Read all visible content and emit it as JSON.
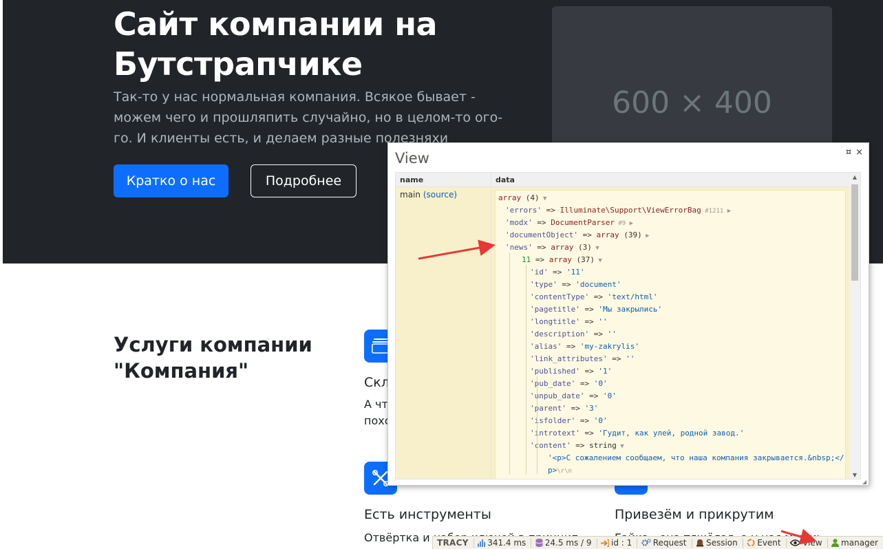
{
  "hero": {
    "title": "Сайт компании на Бутстрапчике",
    "lead": "Так-то у нас нормальная компания. Всякое бывает - можем чего и прошляпить случайно, но в целом-то ого-го. И клиенты есть, и делаем разные полезняхи",
    "primary_button": "Кратко о нас",
    "secondary_button": "Подробнее",
    "image_placeholder": "600 × 400"
  },
  "features": {
    "title": "Услуги компании \"Компания\"",
    "items": [
      {
        "heading": "Скл",
        "text_1": "А что",
        "text_2": "похо"
      },
      {
        "heading": "Есть инструменты",
        "text_1": "Отвёртка и набор ключей в принципе же"
      },
      {
        "heading": "Привезём и прикрутим",
        "text_1": "Гайка - она тяжёлая, а у нас мужик"
      }
    ]
  },
  "tracy_panel": {
    "title": "View",
    "pin_icon": "¤",
    "close_icon": "×",
    "col_name": "name",
    "col_data": "data",
    "row_name": "main",
    "row_source": "(source)",
    "dump": [
      {
        "indent": 0,
        "parts": [
          [
            "arr",
            "array"
          ],
          [
            "plain",
            " (4)"
          ],
          [
            "tri",
            " ▼"
          ]
        ]
      },
      {
        "indent": 1,
        "parts": [
          [
            "k",
            "'errors'"
          ],
          [
            "plain",
            " => "
          ],
          [
            "obj",
            "Illuminate\\Support\\ViewErrorBag"
          ],
          [
            "meta",
            " #1211"
          ],
          [
            "tri",
            " ▶"
          ]
        ]
      },
      {
        "indent": 1,
        "parts": [
          [
            "k",
            "'modx'"
          ],
          [
            "plain",
            " => "
          ],
          [
            "obj",
            "DocumentParser"
          ],
          [
            "meta",
            " #9"
          ],
          [
            "tri",
            " ▶"
          ]
        ]
      },
      {
        "indent": 1,
        "parts": [
          [
            "k",
            "'documentObject'"
          ],
          [
            "plain",
            " => "
          ],
          [
            "arr",
            "array"
          ],
          [
            "plain",
            " (39)"
          ],
          [
            "tri",
            " ▶"
          ]
        ]
      },
      {
        "indent": 1,
        "parts": [
          [
            "k",
            "'news'"
          ],
          [
            "plain",
            " => "
          ],
          [
            "arr",
            "array"
          ],
          [
            "plain",
            " (3)"
          ],
          [
            "tri",
            " ▼"
          ]
        ]
      },
      {
        "indent": 2,
        "parts": [
          [
            "num",
            "11"
          ],
          [
            "plain",
            " => "
          ],
          [
            "arr",
            "array"
          ],
          [
            "plain",
            " (37)"
          ],
          [
            "tri",
            " ▼"
          ]
        ]
      },
      {
        "indent": 3,
        "parts": [
          [
            "k",
            "'id'"
          ],
          [
            "plain",
            " => "
          ],
          [
            "str",
            "'11'"
          ]
        ]
      },
      {
        "indent": 3,
        "parts": [
          [
            "k",
            "'type'"
          ],
          [
            "plain",
            " => "
          ],
          [
            "str",
            "'document'"
          ]
        ]
      },
      {
        "indent": 3,
        "parts": [
          [
            "k",
            "'contentType'"
          ],
          [
            "plain",
            " => "
          ],
          [
            "str",
            "'text/html'"
          ]
        ]
      },
      {
        "indent": 3,
        "parts": [
          [
            "k",
            "'pagetitle'"
          ],
          [
            "plain",
            " => "
          ],
          [
            "str",
            "'Мы закрылись'"
          ]
        ]
      },
      {
        "indent": 3,
        "parts": [
          [
            "k",
            "'longtitle'"
          ],
          [
            "plain",
            " => "
          ],
          [
            "str",
            "''"
          ]
        ]
      },
      {
        "indent": 3,
        "parts": [
          [
            "k",
            "'description'"
          ],
          [
            "plain",
            " => "
          ],
          [
            "str",
            "''"
          ]
        ]
      },
      {
        "indent": 3,
        "parts": [
          [
            "k",
            "'alias'"
          ],
          [
            "plain",
            " => "
          ],
          [
            "str",
            "'my-zakrylis'"
          ]
        ]
      },
      {
        "indent": 3,
        "parts": [
          [
            "k",
            "'link_attributes'"
          ],
          [
            "plain",
            " => "
          ],
          [
            "str",
            "''"
          ]
        ]
      },
      {
        "indent": 3,
        "parts": [
          [
            "k",
            "'published'"
          ],
          [
            "plain",
            " => "
          ],
          [
            "str",
            "'1'"
          ]
        ]
      },
      {
        "indent": 3,
        "parts": [
          [
            "k",
            "'pub_date'"
          ],
          [
            "plain",
            " => "
          ],
          [
            "str",
            "'0'"
          ]
        ]
      },
      {
        "indent": 3,
        "parts": [
          [
            "k",
            "'unpub_date'"
          ],
          [
            "plain",
            " => "
          ],
          [
            "str",
            "'0'"
          ]
        ]
      },
      {
        "indent": 3,
        "parts": [
          [
            "k",
            "'parent'"
          ],
          [
            "plain",
            " => "
          ],
          [
            "str",
            "'3'"
          ]
        ]
      },
      {
        "indent": 3,
        "parts": [
          [
            "k",
            "'isfolder'"
          ],
          [
            "plain",
            " => "
          ],
          [
            "str",
            "'0'"
          ]
        ]
      },
      {
        "indent": 3,
        "parts": [
          [
            "k",
            "'introtext'"
          ],
          [
            "plain",
            " => "
          ],
          [
            "str",
            "'Гудит, как улей, родной завод.'"
          ]
        ]
      },
      {
        "indent": 3,
        "parts": [
          [
            "k",
            "'content'"
          ],
          [
            "plain",
            " => string"
          ],
          [
            "tri",
            " ▼"
          ]
        ]
      },
      {
        "indent": 4,
        "parts": [
          [
            "str",
            "'<p>С сожалением сообщаем, что наша компания закрывается.&nbsp;</"
          ]
        ]
      },
      {
        "indent": 4,
        "parts": [
          [
            "str",
            "p>"
          ],
          [
            "meta",
            "\\r\\n"
          ]
        ]
      }
    ]
  },
  "tracy_bar": {
    "logo": "TRACY",
    "time": "341.4 ms",
    "db": "24.5 ms / 9",
    "id": "id : 1",
    "request": "Request",
    "session": "Session",
    "event": "Event",
    "view": "View",
    "user": "manager"
  },
  "colors": {
    "hero_bg": "#212529",
    "primary": "#0d6efd",
    "panel_cell_bg": "#f7f0cb",
    "annotation_arrow": "#e53935"
  }
}
